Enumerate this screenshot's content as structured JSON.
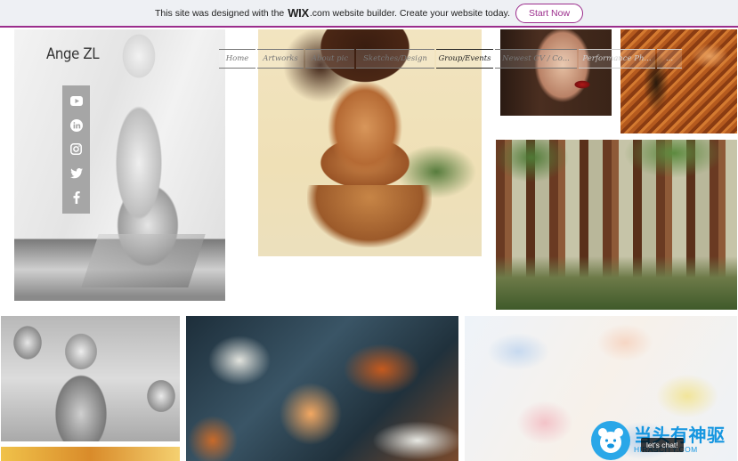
{
  "banner": {
    "text_before": "This site was designed with the",
    "wix_logo": "WIX",
    "wix_dot_com": ".com",
    "text_after": "website builder. Create your website today.",
    "cta_label": "Start Now",
    "accent_color": "#9b2d8c"
  },
  "site": {
    "title": "Ange ZL"
  },
  "social": [
    {
      "icon": "youtube-icon"
    },
    {
      "icon": "linkedin-icon"
    },
    {
      "icon": "instagram-icon"
    },
    {
      "icon": "twitter-icon"
    },
    {
      "icon": "facebook-icon"
    }
  ],
  "nav": {
    "items": [
      {
        "label": "Home"
      },
      {
        "label": "Artworks"
      },
      {
        "label": "About pic"
      },
      {
        "label": "Sketches/Design"
      },
      {
        "label": "Group/Events"
      },
      {
        "label": "Newest CV / Co..."
      },
      {
        "label": "Performance Ph..."
      },
      {
        "label": "..."
      }
    ]
  },
  "watermark": {
    "cn_text": "当头有神驱",
    "en_text": "HIRASCITY.COM",
    "chat_label": "let's chat!"
  }
}
